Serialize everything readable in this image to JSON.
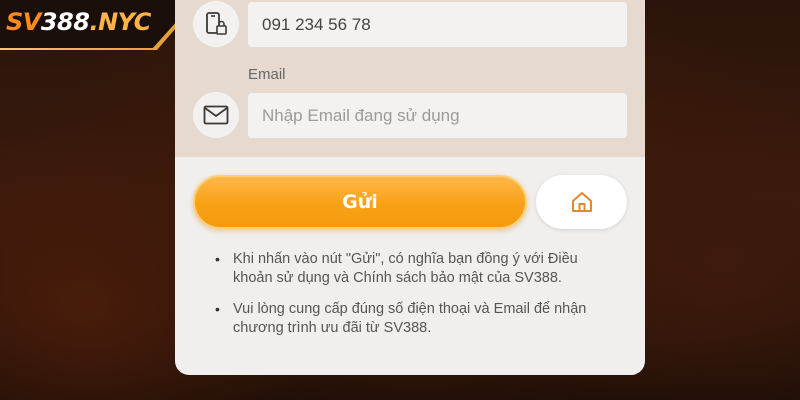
{
  "logo": {
    "sv": "SV",
    "num": "388",
    "nyc": ".NYC"
  },
  "form": {
    "phone": {
      "value": "091 234 56 78",
      "icon": "phone-lock-icon"
    },
    "email": {
      "label": "Email",
      "placeholder": "Nhập Email đang sử dụng",
      "icon": "mail-icon"
    }
  },
  "buttons": {
    "submit_label": "Gửi",
    "home_icon": "home-icon"
  },
  "notes": [
    "Khi nhấn vào nút \"Gửi\", có nghĩa bạn đồng ý với Điều khoản sử dụng và Chính sách bảo mật của SV388.",
    "Vui lòng cung cấp đúng số điện thoại và Email để nhận chương trình ưu đãi từ SV388."
  ],
  "colors": {
    "accent": "#f9a115",
    "icon": "#3a3a3a",
    "home_icon": "#e08a2a"
  }
}
